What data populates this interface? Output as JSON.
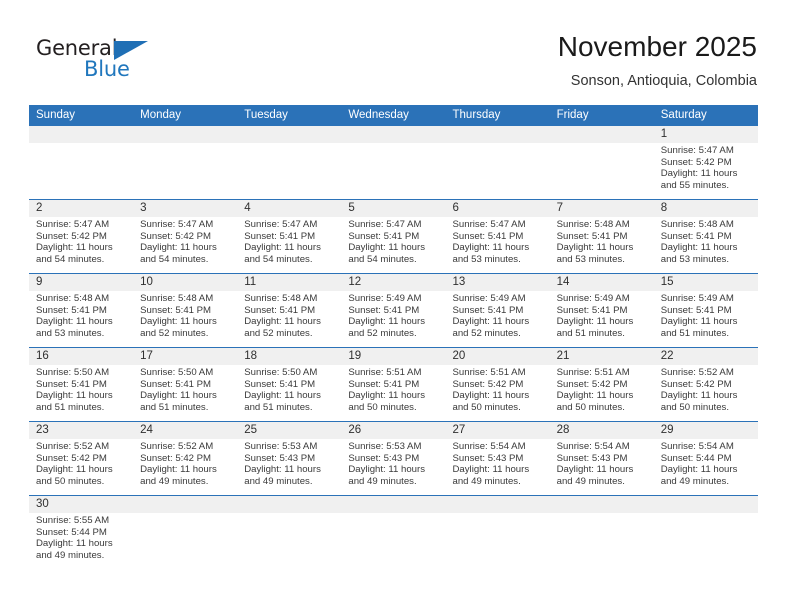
{
  "brand": {
    "name_part1": "General",
    "name_part2": "Blue",
    "flag_icon": "triangle-flag-icon",
    "accent_color": "#2077bd"
  },
  "header": {
    "title": "November 2025",
    "subtitle": "Sonson, Antioquia, Colombia"
  },
  "theme": {
    "header_bar_color": "#2b72b8",
    "date_band_color": "#f0f0f0",
    "week_rule_color": "#2b72b8",
    "text_color": "#3a3a3a"
  },
  "calendar": {
    "day_headers": [
      "Sunday",
      "Monday",
      "Tuesday",
      "Wednesday",
      "Thursday",
      "Friday",
      "Saturday"
    ],
    "weeks": [
      [
        {
          "day": "",
          "lines": []
        },
        {
          "day": "",
          "lines": []
        },
        {
          "day": "",
          "lines": []
        },
        {
          "day": "",
          "lines": []
        },
        {
          "day": "",
          "lines": []
        },
        {
          "day": "",
          "lines": []
        },
        {
          "day": "1",
          "lines": [
            "Sunrise: 5:47 AM",
            "Sunset: 5:42 PM",
            "Daylight: 11 hours",
            "and 55 minutes."
          ]
        }
      ],
      [
        {
          "day": "2",
          "lines": [
            "Sunrise: 5:47 AM",
            "Sunset: 5:42 PM",
            "Daylight: 11 hours",
            "and 54 minutes."
          ]
        },
        {
          "day": "3",
          "lines": [
            "Sunrise: 5:47 AM",
            "Sunset: 5:42 PM",
            "Daylight: 11 hours",
            "and 54 minutes."
          ]
        },
        {
          "day": "4",
          "lines": [
            "Sunrise: 5:47 AM",
            "Sunset: 5:41 PM",
            "Daylight: 11 hours",
            "and 54 minutes."
          ]
        },
        {
          "day": "5",
          "lines": [
            "Sunrise: 5:47 AM",
            "Sunset: 5:41 PM",
            "Daylight: 11 hours",
            "and 54 minutes."
          ]
        },
        {
          "day": "6",
          "lines": [
            "Sunrise: 5:47 AM",
            "Sunset: 5:41 PM",
            "Daylight: 11 hours",
            "and 53 minutes."
          ]
        },
        {
          "day": "7",
          "lines": [
            "Sunrise: 5:48 AM",
            "Sunset: 5:41 PM",
            "Daylight: 11 hours",
            "and 53 minutes."
          ]
        },
        {
          "day": "8",
          "lines": [
            "Sunrise: 5:48 AM",
            "Sunset: 5:41 PM",
            "Daylight: 11 hours",
            "and 53 minutes."
          ]
        }
      ],
      [
        {
          "day": "9",
          "lines": [
            "Sunrise: 5:48 AM",
            "Sunset: 5:41 PM",
            "Daylight: 11 hours",
            "and 53 minutes."
          ]
        },
        {
          "day": "10",
          "lines": [
            "Sunrise: 5:48 AM",
            "Sunset: 5:41 PM",
            "Daylight: 11 hours",
            "and 52 minutes."
          ]
        },
        {
          "day": "11",
          "lines": [
            "Sunrise: 5:48 AM",
            "Sunset: 5:41 PM",
            "Daylight: 11 hours",
            "and 52 minutes."
          ]
        },
        {
          "day": "12",
          "lines": [
            "Sunrise: 5:49 AM",
            "Sunset: 5:41 PM",
            "Daylight: 11 hours",
            "and 52 minutes."
          ]
        },
        {
          "day": "13",
          "lines": [
            "Sunrise: 5:49 AM",
            "Sunset: 5:41 PM",
            "Daylight: 11 hours",
            "and 52 minutes."
          ]
        },
        {
          "day": "14",
          "lines": [
            "Sunrise: 5:49 AM",
            "Sunset: 5:41 PM",
            "Daylight: 11 hours",
            "and 51 minutes."
          ]
        },
        {
          "day": "15",
          "lines": [
            "Sunrise: 5:49 AM",
            "Sunset: 5:41 PM",
            "Daylight: 11 hours",
            "and 51 minutes."
          ]
        }
      ],
      [
        {
          "day": "16",
          "lines": [
            "Sunrise: 5:50 AM",
            "Sunset: 5:41 PM",
            "Daylight: 11 hours",
            "and 51 minutes."
          ]
        },
        {
          "day": "17",
          "lines": [
            "Sunrise: 5:50 AM",
            "Sunset: 5:41 PM",
            "Daylight: 11 hours",
            "and 51 minutes."
          ]
        },
        {
          "day": "18",
          "lines": [
            "Sunrise: 5:50 AM",
            "Sunset: 5:41 PM",
            "Daylight: 11 hours",
            "and 51 minutes."
          ]
        },
        {
          "day": "19",
          "lines": [
            "Sunrise: 5:51 AM",
            "Sunset: 5:41 PM",
            "Daylight: 11 hours",
            "and 50 minutes."
          ]
        },
        {
          "day": "20",
          "lines": [
            "Sunrise: 5:51 AM",
            "Sunset: 5:42 PM",
            "Daylight: 11 hours",
            "and 50 minutes."
          ]
        },
        {
          "day": "21",
          "lines": [
            "Sunrise: 5:51 AM",
            "Sunset: 5:42 PM",
            "Daylight: 11 hours",
            "and 50 minutes."
          ]
        },
        {
          "day": "22",
          "lines": [
            "Sunrise: 5:52 AM",
            "Sunset: 5:42 PM",
            "Daylight: 11 hours",
            "and 50 minutes."
          ]
        }
      ],
      [
        {
          "day": "23",
          "lines": [
            "Sunrise: 5:52 AM",
            "Sunset: 5:42 PM",
            "Daylight: 11 hours",
            "and 50 minutes."
          ]
        },
        {
          "day": "24",
          "lines": [
            "Sunrise: 5:52 AM",
            "Sunset: 5:42 PM",
            "Daylight: 11 hours",
            "and 49 minutes."
          ]
        },
        {
          "day": "25",
          "lines": [
            "Sunrise: 5:53 AM",
            "Sunset: 5:43 PM",
            "Daylight: 11 hours",
            "and 49 minutes."
          ]
        },
        {
          "day": "26",
          "lines": [
            "Sunrise: 5:53 AM",
            "Sunset: 5:43 PM",
            "Daylight: 11 hours",
            "and 49 minutes."
          ]
        },
        {
          "day": "27",
          "lines": [
            "Sunrise: 5:54 AM",
            "Sunset: 5:43 PM",
            "Daylight: 11 hours",
            "and 49 minutes."
          ]
        },
        {
          "day": "28",
          "lines": [
            "Sunrise: 5:54 AM",
            "Sunset: 5:43 PM",
            "Daylight: 11 hours",
            "and 49 minutes."
          ]
        },
        {
          "day": "29",
          "lines": [
            "Sunrise: 5:54 AM",
            "Sunset: 5:44 PM",
            "Daylight: 11 hours",
            "and 49 minutes."
          ]
        }
      ],
      [
        {
          "day": "30",
          "lines": [
            "Sunrise: 5:55 AM",
            "Sunset: 5:44 PM",
            "Daylight: 11 hours",
            "and 49 minutes."
          ]
        },
        {
          "day": "",
          "lines": []
        },
        {
          "day": "",
          "lines": []
        },
        {
          "day": "",
          "lines": []
        },
        {
          "day": "",
          "lines": []
        },
        {
          "day": "",
          "lines": []
        },
        {
          "day": "",
          "lines": []
        }
      ]
    ]
  }
}
